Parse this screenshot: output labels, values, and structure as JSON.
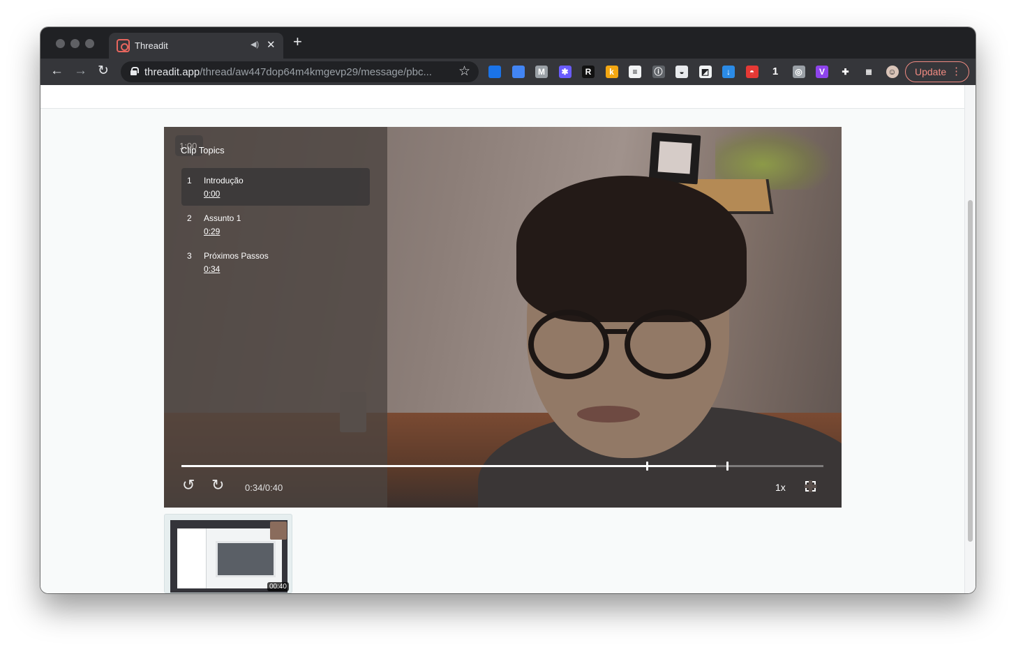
{
  "browser": {
    "tab": {
      "title": "Threadit",
      "audio_icon": "speaker-icon",
      "close_icon": "close-icon",
      "favicon": "threadit-favicon-icon"
    },
    "new_tab_icon": "plus-icon",
    "nav": {
      "back_icon": "arrow-left-icon",
      "forward_icon": "arrow-right-icon",
      "reload_icon": "reload-icon"
    },
    "address": {
      "host": "threadit.app",
      "path": "/thread/aw447dop64m4kmgevp29/message/pbc...",
      "lock_icon": "lock-icon",
      "bookmark_icon": "star-icon"
    },
    "extensions": [
      {
        "name": "gem-extension-icon",
        "text": "",
        "color": "#1a73e8"
      },
      {
        "name": "share-extension-icon",
        "text": "",
        "color": "#4285f4"
      },
      {
        "name": "m-extension-icon",
        "text": "M",
        "color": "#9aa0a6"
      },
      {
        "name": "asterisk-extension-icon",
        "text": "✱",
        "color": "#6a5cff"
      },
      {
        "name": "r-extension-icon",
        "text": "R",
        "color": "#111111"
      },
      {
        "name": "k-extension-icon",
        "text": "k",
        "color": "#f3a712"
      },
      {
        "name": "notes-extension-icon",
        "text": "≡",
        "color": "#f1f3f4"
      },
      {
        "name": "info-extension-icon",
        "text": "ⓘ",
        "color": "#5f6368"
      },
      {
        "name": "wave-extension-icon",
        "text": "◒",
        "color": "#e8eaed"
      },
      {
        "name": "edit-extension-icon",
        "text": "◩",
        "color": "#f1f3f4"
      },
      {
        "name": "download-extension-icon",
        "text": "↓",
        "color": "#2b8be6"
      },
      {
        "name": "pokeball-extension-icon",
        "text": "◓",
        "color": "#e53935"
      },
      {
        "name": "one-extension-icon",
        "text": "1",
        "color": "#35363a"
      },
      {
        "name": "spinner-extension-icon",
        "text": "◎",
        "color": "#9aa0a6"
      },
      {
        "name": "v-extension-icon",
        "text": "V",
        "color": "#8e44ec"
      },
      {
        "name": "puzzle-extension-icon",
        "text": "✚",
        "color": "#35363a"
      },
      {
        "name": "media-queue-icon",
        "text": "≣",
        "color": "#35363a"
      },
      {
        "name": "profile-avatar-icon",
        "text": "☺",
        "color": "#d9c4b8"
      }
    ],
    "update_label": "Update",
    "menu_icon": "kebab-menu-icon"
  },
  "player": {
    "ghost_time": "1:00",
    "sidebar_title": "Clip Topics",
    "topics": [
      {
        "num": "1",
        "label": "Introdução",
        "time": "0:00",
        "active": true
      },
      {
        "num": "2",
        "label": "Assunto 1",
        "time": "0:29",
        "active": false
      },
      {
        "num": "3",
        "label": "Próximos Passos",
        "time": "0:34",
        "active": false
      }
    ],
    "progress": {
      "played_fraction": 0.833,
      "chapter_marks_fraction": [
        0.725,
        0.85
      ]
    },
    "time_display": "0:34/0:40",
    "speed": "1x",
    "rewind_icon": "rewind-5-icon",
    "forward_icon": "forward-5-icon",
    "fullscreen_icon": "fullscreen-icon"
  },
  "thumbnail": {
    "duration": "00:40"
  }
}
